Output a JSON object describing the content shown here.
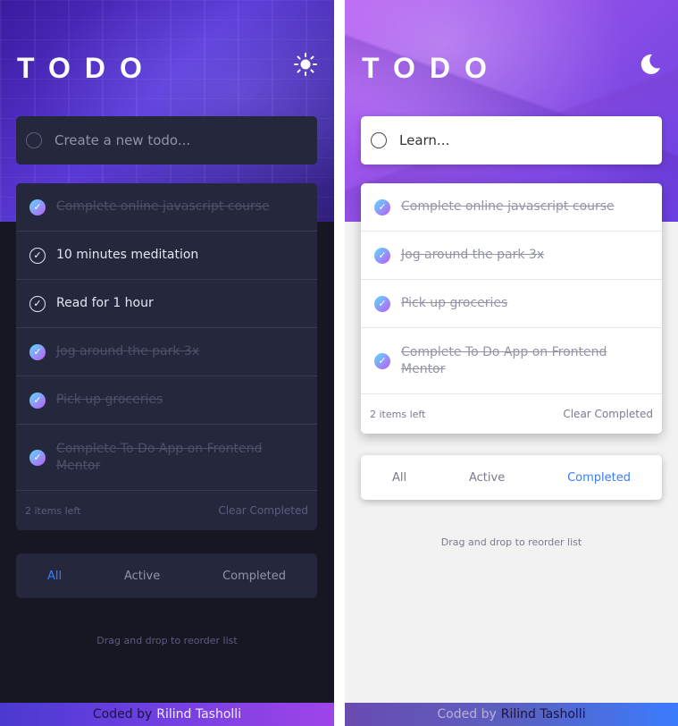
{
  "dark": {
    "title": "TODO",
    "theme_icon": "sun-icon",
    "input_placeholder": "Create a new todo...",
    "items": [
      {
        "text": "Complete online javascript course",
        "completed": true
      },
      {
        "text": "10 minutes meditation",
        "completed": false
      },
      {
        "text": "Read for 1 hour",
        "completed": false
      },
      {
        "text": "Jog around the park 3x",
        "completed": true
      },
      {
        "text": "Pick up groceries",
        "completed": true
      },
      {
        "text": "Complete To Do App on Frontend Mentor",
        "completed": true
      }
    ],
    "items_left": "2 items left",
    "clear_label": "Clear Completed",
    "filters": [
      {
        "label": "All",
        "active": true
      },
      {
        "label": "Active",
        "active": false
      },
      {
        "label": "Completed",
        "active": false
      }
    ],
    "hint": "Drag and drop to reorder list",
    "attribution_prefix": "Coded by",
    "attribution_author": "Rilind Tasholli"
  },
  "light": {
    "title": "TODO",
    "theme_icon": "moon-icon",
    "input_value": "Learn...",
    "items": [
      {
        "text": "Complete online javascript course",
        "completed": true
      },
      {
        "text": "Jog around the park 3x",
        "completed": true
      },
      {
        "text": "Pick up groceries",
        "completed": true
      },
      {
        "text": "Complete To Do App on Frontend Mentor",
        "completed": true
      }
    ],
    "items_left": "2 items left",
    "clear_label": "Clear Completed",
    "filters": [
      {
        "label": "All",
        "active": false
      },
      {
        "label": "Active",
        "active": false
      },
      {
        "label": "Completed",
        "active": true
      }
    ],
    "hint": "Drag and drop to reorder list",
    "attribution_prefix": "Coded by",
    "attribution_author": "Rilind Tasholli"
  },
  "colors": {
    "accent": "#3a7cfd",
    "check_gradient_start": "#57ddff",
    "check_gradient_end": "#c058f3",
    "dark_bg": "#161722",
    "dark_card": "#25273c",
    "light_bg": "#f2f2f2"
  }
}
